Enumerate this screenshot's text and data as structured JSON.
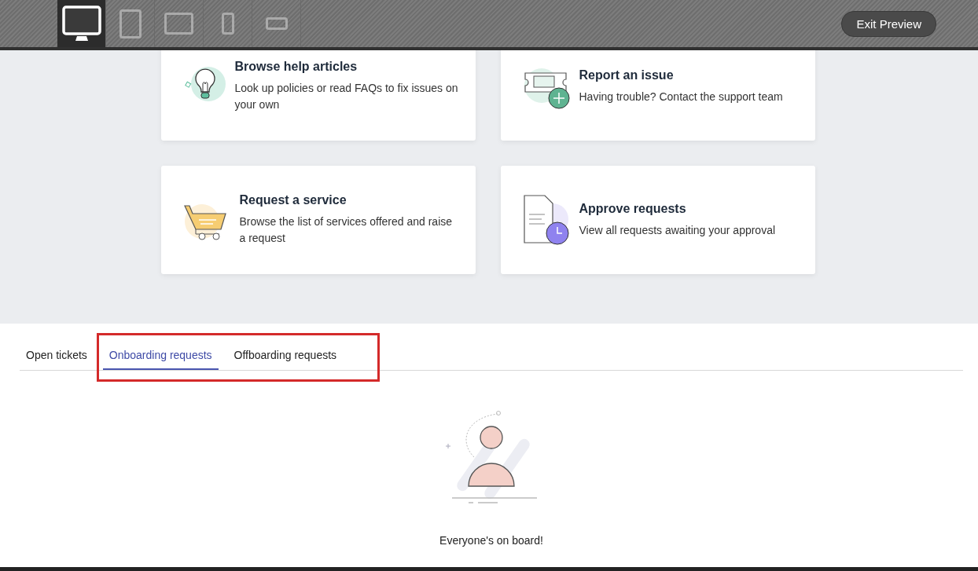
{
  "devices": [
    {
      "kind": "desktop",
      "selected": true
    },
    {
      "kind": "tablet",
      "selected": false
    },
    {
      "kind": "tablet-landscape",
      "selected": false
    },
    {
      "kind": "phone",
      "selected": false
    },
    {
      "kind": "phone-landscape",
      "selected": false
    }
  ],
  "exit_button": "Exit Preview",
  "cards": [
    {
      "kind": "bulb",
      "title": "Browse help articles",
      "description": "Look up policies or read FAQs to fix issues on your own"
    },
    {
      "kind": "ticket",
      "title": "Report an issue",
      "description": "Having trouble? Contact the support team"
    },
    {
      "kind": "cart",
      "title": "Request a service",
      "description": "Browse the list of services offered and raise a request"
    },
    {
      "kind": "approval",
      "title": "Approve requests",
      "description": "View all requests awaiting your approval"
    }
  ],
  "tabs": [
    {
      "label": "Open tickets",
      "selected": false
    },
    {
      "label": "Onboarding requests",
      "selected": true
    },
    {
      "label": "Offboarding requests",
      "selected": false
    }
  ],
  "empty_message": "Everyone's on board!"
}
